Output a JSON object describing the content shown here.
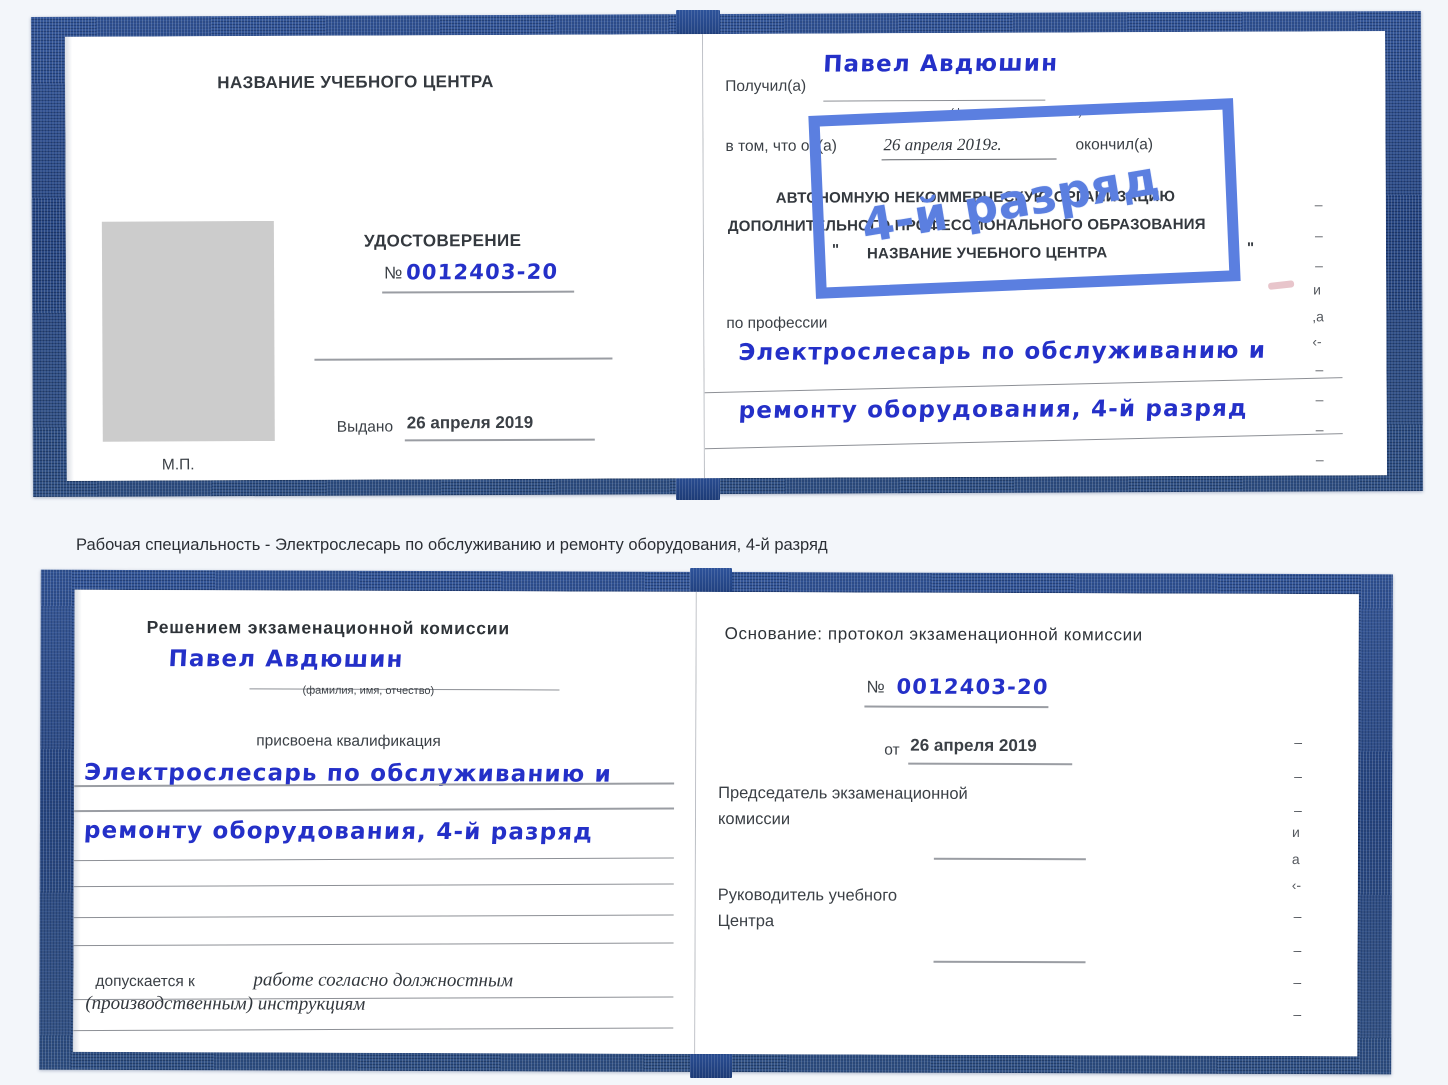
{
  "meta": {
    "accent_blue": "#1f3f7e",
    "handwriting_blue": "#2430c8",
    "stamp_blue": "#5b7fe0",
    "page_white": "#ffffff",
    "rule_gray": "#8d9096",
    "photo_gray": "#cccccc",
    "background": "#f3f6fa"
  },
  "caption": {
    "text": "Рабочая специальность - Электрослесарь по обслуживанию и ремонту оборудования, 4-й разряд"
  },
  "certificate_top": {
    "left_page": {
      "heading": "НАЗВАНИЕ УЧЕБНОГО ЦЕНТРА",
      "doc_type": "УДОСТОВЕРЕНИЕ",
      "number_symbol": "№",
      "number_value": "0012403-20",
      "issued_label": "Выдано",
      "issued_value": "26 апреля 2019",
      "seal_label": "М.П.",
      "photo_placeholder": "photo-placeholder"
    },
    "right_page": {
      "received_label": "Получил(а)",
      "received_value": "Павел Авдюшин",
      "fio_hint": "(фамилия, имя, отчество)",
      "that_he_label": "в том, что он(а)",
      "completion_date": "26 апреля 2019г.",
      "finished_label": "окончил(а)",
      "org_line1": "АВТОНОМНУЮ НЕКОММЕРЧЕСКУЮ ОРГАНИЗАЦИЮ",
      "org_line2": "ДОПОЛНИТЕЛЬНОГО ПРОФЕССИОНАЛЬНОГО ОБРАЗОВАНИЯ",
      "org_quote_open": "\"",
      "org_name": "НАЗВАНИЕ УЧЕБНОГО ЦЕНТРА",
      "org_quote_close": "\"",
      "profession_label": "по профессии",
      "profession_line1": "Электрослесарь по обслуживанию и",
      "profession_line2": "ремонту оборудования, 4-й разряд",
      "stamp_text": "4-й разряд"
    },
    "edge_fragments": [
      "–",
      "–",
      "–",
      "и",
      ",а",
      "‹-",
      "–",
      "–",
      "–",
      "–"
    ]
  },
  "certificate_bottom": {
    "left_page": {
      "heading": "Решением экзаменационной комиссии",
      "name_value": "Павел Авдюшин",
      "fio_hint": "(фамилия, имя, отчество)",
      "qualification_label": "присвоена квалификация",
      "qualification_line1": "Электрослесарь по обслуживанию и",
      "qualification_line2": "ремонту оборудования, 4-й разряд",
      "allowed_label": "допускается к",
      "allowed_value_line1": "работе согласно должностным",
      "allowed_value_line2": "(производственным) инструкциям"
    },
    "right_page": {
      "basis_label": "Основание: протокол экзаменационной комиссии",
      "number_symbol": "№",
      "number_value": "0012403-20",
      "from_label": "от",
      "from_value": "26 апреля 2019",
      "chairman_line1": "Председатель экзаменационной",
      "chairman_line2": "комиссии",
      "head_line1": "Руководитель учебного",
      "head_line2": "Центра"
    },
    "edge_fragments": [
      "–",
      "–",
      "–",
      "и",
      "а",
      "‹-",
      "–",
      "–",
      "–",
      "–"
    ]
  }
}
